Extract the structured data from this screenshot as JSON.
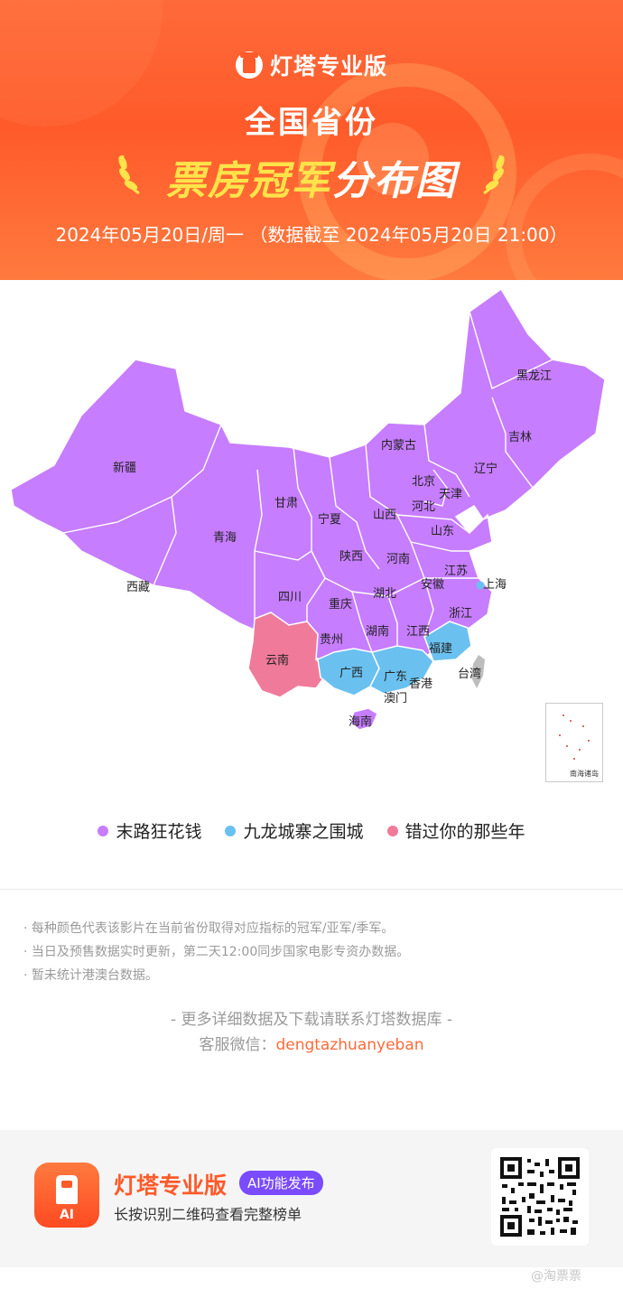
{
  "header": {
    "brand": "灯塔专业版",
    "title_line1": "全国省份",
    "title_line2_highlight": "票房冠军",
    "title_line2_rest": "分布图",
    "date_line": "2024年05月20日/周一 （数据截至 2024年05月20日 21:00）"
  },
  "colors": {
    "header_orange": "#ff5a2a",
    "purple": "#c77dff",
    "blue": "#6ac1f0",
    "pink": "#f07a9a",
    "gray": "#bdbdbd",
    "link_orange": "#ff6a3a"
  },
  "map": {
    "provinces": [
      {
        "name": "黑龙江",
        "film": "末路狂花钱"
      },
      {
        "name": "吉林",
        "film": "末路狂花钱"
      },
      {
        "name": "辽宁",
        "film": "末路狂花钱"
      },
      {
        "name": "内蒙古",
        "film": "末路狂花钱"
      },
      {
        "name": "新疆",
        "film": "末路狂花钱"
      },
      {
        "name": "北京",
        "film": "末路狂花钱"
      },
      {
        "name": "天津",
        "film": "末路狂花钱"
      },
      {
        "name": "河北",
        "film": "末路狂花钱"
      },
      {
        "name": "甘肃",
        "film": "末路狂花钱"
      },
      {
        "name": "宁夏",
        "film": "末路狂花钱"
      },
      {
        "name": "山西",
        "film": "末路狂花钱"
      },
      {
        "name": "山东",
        "film": "末路狂花钱"
      },
      {
        "name": "青海",
        "film": "末路狂花钱"
      },
      {
        "name": "陕西",
        "film": "末路狂花钱"
      },
      {
        "name": "河南",
        "film": "末路狂花钱"
      },
      {
        "name": "江苏",
        "film": "末路狂花钱"
      },
      {
        "name": "西藏",
        "film": "末路狂花钱"
      },
      {
        "name": "四川",
        "film": "末路狂花钱"
      },
      {
        "name": "安徽",
        "film": "末路狂花钱"
      },
      {
        "name": "上海",
        "film": "九龙城寨之围城"
      },
      {
        "name": "重庆",
        "film": "末路狂花钱"
      },
      {
        "name": "湖北",
        "film": "末路狂花钱"
      },
      {
        "name": "浙江",
        "film": "末路狂花钱"
      },
      {
        "name": "贵州",
        "film": "末路狂花钱"
      },
      {
        "name": "湖南",
        "film": "末路狂花钱"
      },
      {
        "name": "江西",
        "film": "末路狂花钱"
      },
      {
        "name": "云南",
        "film": "错过你的那些年"
      },
      {
        "name": "福建",
        "film": "九龙城寨之围城"
      },
      {
        "name": "广西",
        "film": "九龙城寨之围城"
      },
      {
        "name": "广东",
        "film": "九龙城寨之围城"
      },
      {
        "name": "香港",
        "film": ""
      },
      {
        "name": "台湾",
        "film": ""
      },
      {
        "name": "澳门",
        "film": ""
      },
      {
        "name": "海南",
        "film": "末路狂花钱"
      }
    ],
    "inset_caption": "南海诸岛"
  },
  "legend": [
    {
      "label": "末路狂花钱",
      "color": "#c77dff"
    },
    {
      "label": "九龙城寨之围城",
      "color": "#6ac1f0"
    },
    {
      "label": "错过你的那些年",
      "color": "#f07a9a"
    }
  ],
  "notes": [
    "· 每种颜色代表该影片在当前省份取得对应指标的冠军/亚军/季军。",
    "· 当日及预售数据实时更新，第二天12:00同步国家电影专资办数据。",
    "· 暂未统计港澳台数据。"
  ],
  "contact": {
    "more_line": "- 更多详细数据及下载请联系灯塔数据库 -",
    "wechat_prefix": "客服微信：",
    "wechat_id": "dengtazhuanyeban"
  },
  "footer": {
    "app_icon_text": "AI",
    "title": "灯塔专业版",
    "badge": "AI功能发布",
    "subtitle": "长按识别二维码查看完整榜单"
  },
  "watermark": "@淘票票"
}
